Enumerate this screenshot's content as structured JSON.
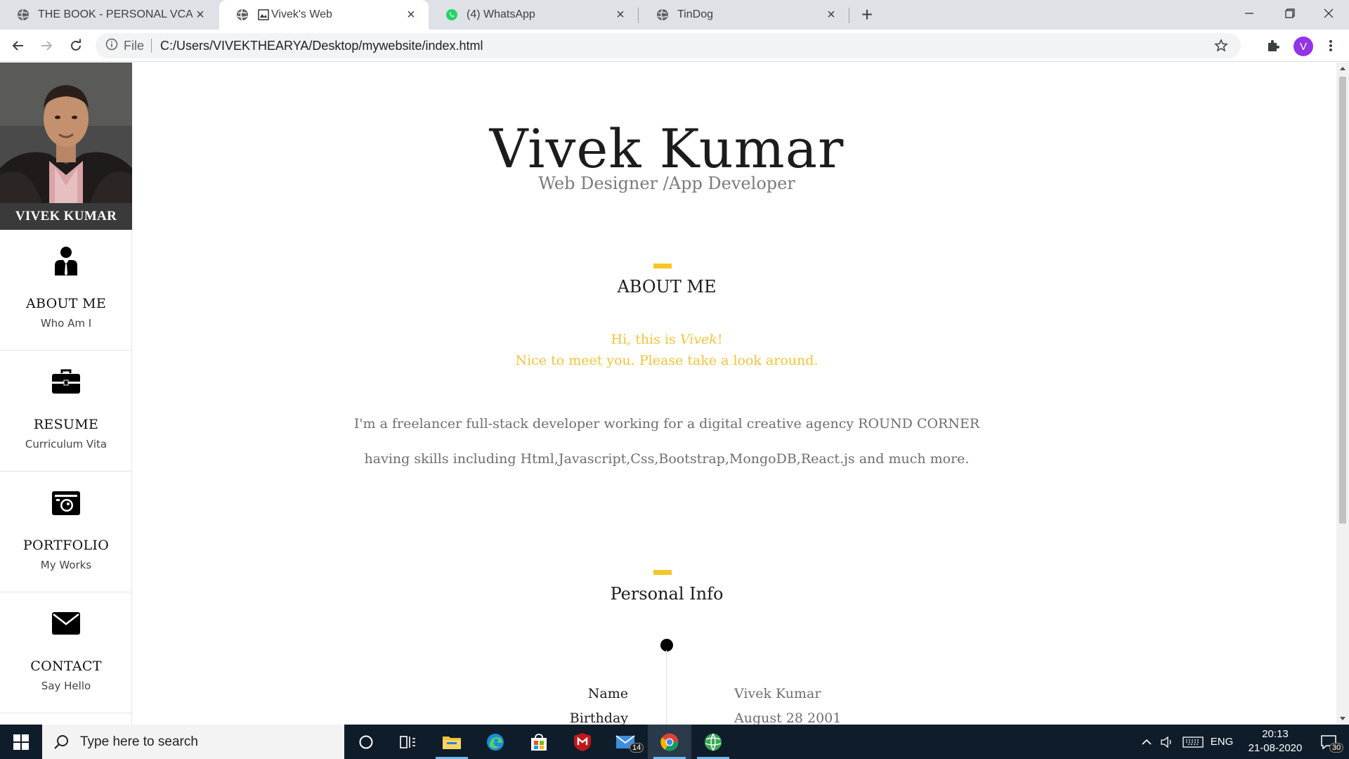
{
  "browser": {
    "tabs": [
      {
        "title": "THE BOOK - PERSONAL VCARD HTML TEMPLATE",
        "active": false
      },
      {
        "title": "Vivek's Web",
        "active": true
      },
      {
        "title": "(4) WhatsApp",
        "active": false
      },
      {
        "title": "TinDog",
        "active": false
      }
    ],
    "address": {
      "scheme": "File",
      "url": "C:/Users/VIVEKTHEARYA/Desktop/mywebsite/index.html"
    },
    "profile_initial": "V"
  },
  "page": {
    "sidebar": {
      "name": "VIVEK KUMAR",
      "items": [
        {
          "title": "ABOUT ME",
          "subtitle": "Who Am I",
          "icon": "person-icon"
        },
        {
          "title": "RESUME",
          "subtitle": "Curriculum Vita",
          "icon": "briefcase-icon"
        },
        {
          "title": "PORTFOLIO",
          "subtitle": "My Works",
          "icon": "camera-icon"
        },
        {
          "title": "CONTACT",
          "subtitle": "Say Hello",
          "icon": "envelope-icon"
        }
      ]
    },
    "hero": {
      "name": "Vivek Kumar",
      "role": "Web Designer /App Developer"
    },
    "about": {
      "title": "ABOUT ME",
      "greeting_prefix": "Hi, this is ",
      "greeting_name": "Vivek",
      "greeting_suffix": "!",
      "greeting_line2": "Nice to meet you. Please take a look around.",
      "bio_line1": "I'm a freelancer full-stack developer working for a digital creative agency ROUND CORNER",
      "bio_line2": "having skills including Html,Javascript,Css,Bootstrap,MongoDB,React.js and much more."
    },
    "personal_info": {
      "title": "Personal Info",
      "rows": [
        {
          "label": "Name",
          "value": "Vivek Kumar"
        },
        {
          "label": "Birthday",
          "value": "August 28 2001"
        }
      ]
    }
  },
  "taskbar": {
    "search_placeholder": "Type here to search",
    "language": "ENG",
    "time": "20:13",
    "date": "21-08-2020",
    "mail_badge": "14",
    "notification_count": "30"
  },
  "colors": {
    "accent_yellow": "#f6c624",
    "sidebar_namebar": "#3a3a3a",
    "taskbar": "#0f1d2b"
  }
}
